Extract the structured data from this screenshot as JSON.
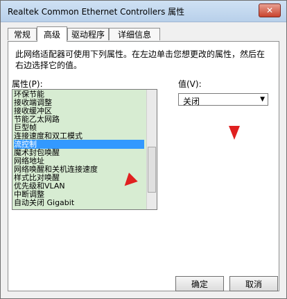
{
  "window": {
    "title": "Realtek Common Ethernet Controllers 属性"
  },
  "tabs": [
    "常规",
    "高级",
    "驱动程序",
    "详细信息"
  ],
  "description": "此网络适配器可使用下列属性。在左边单击您想更改的属性，然后在右边选择它的值。",
  "labels": {
    "properties": "属性(P):",
    "value": "值(V):"
  },
  "properties_list": [
    "环保节能",
    "接收端调整",
    "接收缓冲区",
    "节能乙太网路",
    "巨型帧",
    "连接速度和双工模式",
    "流控制",
    "魔术封包唤醒",
    "网络地址",
    "网络唤醒和关机连接速度",
    "样式比对唤醒",
    "优先级和VLAN",
    "中断调整",
    "自动关闭 Gigabit"
  ],
  "selected_property_index": 6,
  "value_select": {
    "selected": "关闭"
  },
  "footer_buttons": {
    "ok": "确定",
    "cancel": "取消"
  },
  "icons": {
    "close": "close-icon",
    "dropdown": "chevron-down-icon"
  },
  "colors": {
    "selection": "#3399ff",
    "list_background": "#d7ecd2",
    "annotation_arrow": "#e02020"
  }
}
